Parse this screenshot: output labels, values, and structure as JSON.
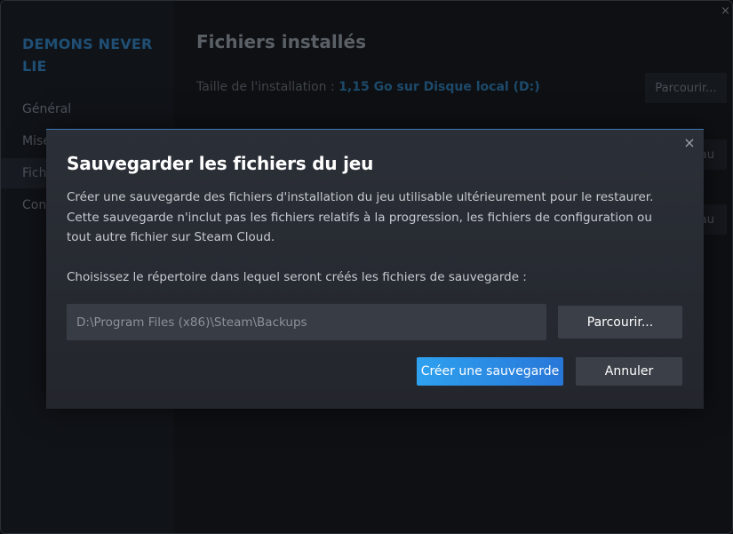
{
  "background": {
    "game_title": "DEMONS NEVER LIE",
    "sidebar": {
      "items": [
        {
          "label": "Général"
        },
        {
          "label": "Mise"
        },
        {
          "label": "Fich"
        },
        {
          "label": "Con"
        }
      ]
    },
    "main_title": "Fichiers installés",
    "install_size_label": "Taille de l'installation : ",
    "install_size_value": "1,15 Go sur Disque local (D:)",
    "browse_button": "Parcourir...",
    "partial_button_1": "au",
    "partial_button_2": "au",
    "close_label": "×"
  },
  "dialog": {
    "close_label": "×",
    "title": "Sauvegarder les fichiers du jeu",
    "description": "Créer une sauvegarde des fichiers d'installation du jeu utilisable ultérieurement pour le restaurer. Cette sauvegarde n'inclut pas les fichiers relatifs à la progression, les fichiers de configuration ou tout autre fichier sur Steam Cloud.",
    "directory_label": "Choisissez le répertoire dans lequel seront créés les fichiers de sauvegarde :",
    "path_value": "D:\\Program Files (x86)\\Steam\\Backups",
    "browse_button": "Parcourir...",
    "create_button": "Créer une sauvegarde",
    "cancel_button": "Annuler"
  },
  "colors": {
    "accent_blue": "#2ea1ef",
    "dialog_bg": "#2b2f37",
    "input_bg": "#383c44",
    "secondary_button": "#3b3f47"
  }
}
